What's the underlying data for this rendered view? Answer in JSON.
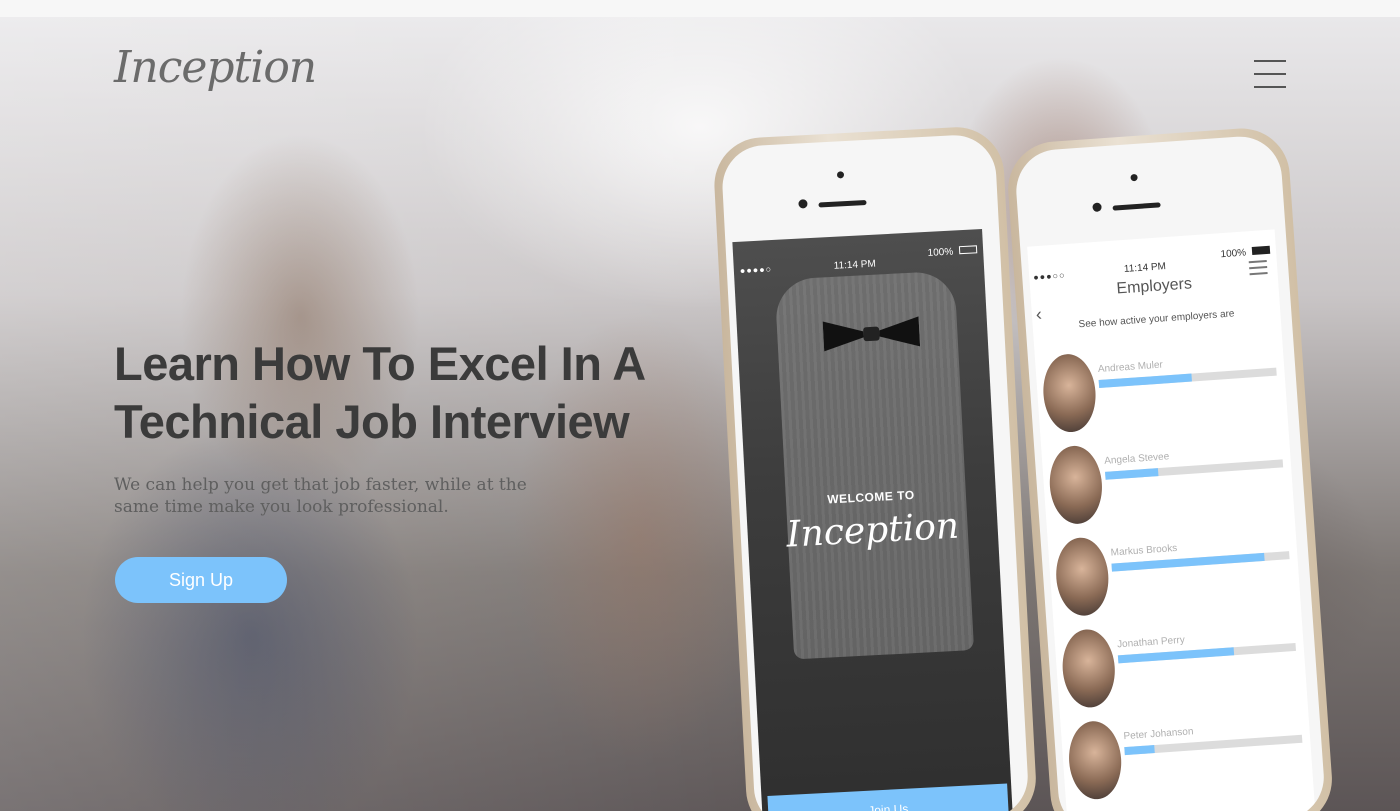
{
  "header": {
    "logo": "Inception",
    "menu_label": "menu"
  },
  "hero": {
    "headline_line1": "Learn How To Excel In A",
    "headline_line2": "Technical Job Interview",
    "subtext_line1": "We can help you get that job faster, while at the",
    "subtext_line2": "same time make you look professional.",
    "cta_label": "Sign Up"
  },
  "phone_left": {
    "status_time": "11:14 PM",
    "status_battery": "100%",
    "welcome": "WELCOME TO",
    "logo": "Inception",
    "join_label": "Join Us"
  },
  "phone_right": {
    "status_time": "11:14 PM",
    "status_battery": "100%",
    "title": "Employers",
    "subtitle": "See how active your employers are",
    "employers": [
      {
        "name": "Andreas Muler",
        "activity": 0.52
      },
      {
        "name": "Angela Stevee",
        "activity": 0.3
      },
      {
        "name": "Markus Brooks",
        "activity": 0.86
      },
      {
        "name": "Jonathan Perry",
        "activity": 0.65
      },
      {
        "name": "Peter Johanson",
        "activity": 0.17
      }
    ]
  },
  "colors": {
    "accent": "#7cc3fb",
    "headline": "#3b3b3b",
    "subtext": "#5f5f5f"
  }
}
